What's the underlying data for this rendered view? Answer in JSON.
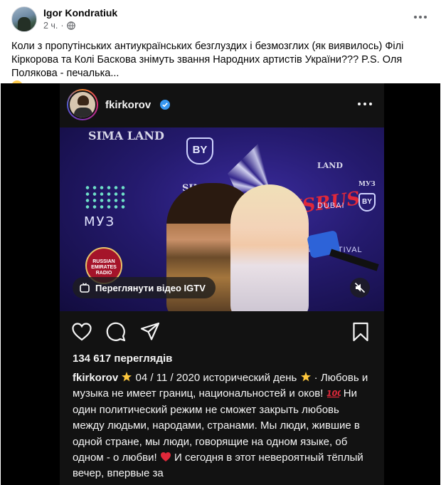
{
  "post": {
    "author": "Igor Kondratiuk",
    "time": "2 ч.",
    "privacy_icon": "globe-icon",
    "text": "Коли з пропутінських антиукраїнських безглуздих і безмозглих (як виявилось) Філі Кіркорова та Колі Баскова знімуть звання Народних артистів України??? P.S. Оля Полякова - печалька...",
    "emoji": "face-screaming-in-fear"
  },
  "instagram": {
    "username": "fkirkorov",
    "verified": true,
    "media": {
      "backdrop_logos": [
        "SIMA LAND",
        "SIMA LAND",
        "МУЗ",
        "BY",
        "BY",
        "DUBAI",
        "RUSSIAN EMIRATES RADIO",
        "MUSIC FESTIVAL",
        "USRUS",
        "LAND",
        "МУЗ"
      ],
      "igtv_button": "Переглянути відео IGTV",
      "mute_icon": "speaker-muted-icon"
    },
    "actions": [
      "heart-icon",
      "comment-icon",
      "share-icon",
      "bookmark-icon"
    ],
    "views": "134 617 переглядів",
    "caption": {
      "username": "fkirkorov",
      "line_segments": [
        "04 / 11 / 2020 исторический день",
        "Любовь и музыка не имеет границ, национальностей и оков!",
        "Ни один политический режим не сможет закрыть любовь между людьми, народами, странами. Мы люди, жившие в одной стране, мы люди, говорящие на одном языке, об одном - о любви!",
        "И сегодня в этот невероятный тёплый вечер, впервые за"
      ]
    }
  }
}
